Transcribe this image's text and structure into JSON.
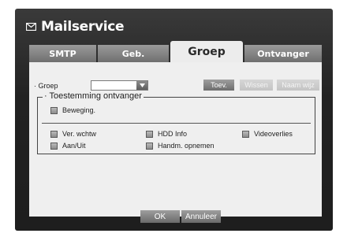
{
  "window": {
    "title": "Mailservice",
    "icon": "mail-icon"
  },
  "tabs": [
    {
      "label": "SMTP",
      "active": false
    },
    {
      "label": "Geb.",
      "active": false
    },
    {
      "label": "Groep",
      "active": true
    },
    {
      "label": "Ontvanger",
      "active": false
    }
  ],
  "group_row": {
    "label": "· Groep",
    "selected": "",
    "buttons": [
      {
        "label": "Toev.",
        "enabled": true
      },
      {
        "label": "Wissen",
        "enabled": false
      },
      {
        "label": "Naam wijz",
        "enabled": false
      }
    ]
  },
  "permissions": {
    "legend": "· Toestemming ontvanger",
    "motion": {
      "label": "Beweging.",
      "checked": false
    },
    "items": [
      {
        "label": "Ver. wchtw",
        "checked": false
      },
      {
        "label": "HDD Info",
        "checked": false
      },
      {
        "label": "Videoverlies",
        "checked": false
      },
      {
        "label": "Aan/Uit",
        "checked": false
      },
      {
        "label": "Handm. opnemen",
        "checked": false
      }
    ]
  },
  "footer": {
    "ok_label": "OK",
    "cancel_label": "Annuleer"
  }
}
